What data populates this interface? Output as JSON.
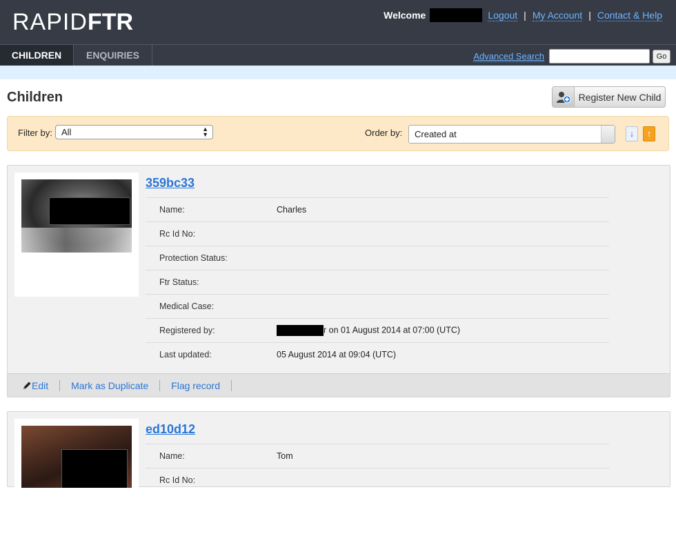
{
  "header": {
    "logo_light": "RAPID",
    "logo_bold": "FTR",
    "welcome": "Welcome",
    "links": [
      "Logout",
      "My Account",
      "Contact & Help"
    ],
    "separator": "|"
  },
  "nav": {
    "tabs": [
      {
        "label": "CHILDREN",
        "active": true
      },
      {
        "label": "ENQUIRIES",
        "active": false
      }
    ],
    "advanced_search": "Advanced Search",
    "search_value": "",
    "go_label": "Go"
  },
  "page": {
    "title": "Children",
    "register_button": "Register New Child"
  },
  "filters": {
    "filter_label": "Filter by:",
    "filter_value": "All",
    "order_label": "Order by:",
    "order_value": "Created at",
    "sort_desc_glyph": "↓",
    "sort_asc_glyph": "↑"
  },
  "records": [
    {
      "id": "359bc33",
      "fields": [
        {
          "label": "Name:",
          "value": "Charles"
        },
        {
          "label": "Rc Id No:",
          "value": ""
        },
        {
          "label": "Protection Status:",
          "value": ""
        },
        {
          "label": "Ftr Status:",
          "value": ""
        },
        {
          "label": "Medical Case:",
          "value": ""
        },
        {
          "label": "Registered by:",
          "value": "r on 01 August 2014 at 07:00 (UTC)"
        },
        {
          "label": "Last updated:",
          "value": "05 August 2014 at 09:04 (UTC)"
        }
      ],
      "actions": [
        "Edit",
        "Mark as Duplicate",
        "Flag record"
      ]
    },
    {
      "id": "ed10d12",
      "fields": [
        {
          "label": "Name:",
          "value": "Tom"
        },
        {
          "label": "Rc Id No:",
          "value": ""
        }
      ]
    }
  ],
  "colors": {
    "header_bg": "#363b46",
    "link": "#2a76d6",
    "header_link": "#6fb4ff",
    "filter_bg": "#fde9c7",
    "sort_active": "#f6a21e"
  }
}
